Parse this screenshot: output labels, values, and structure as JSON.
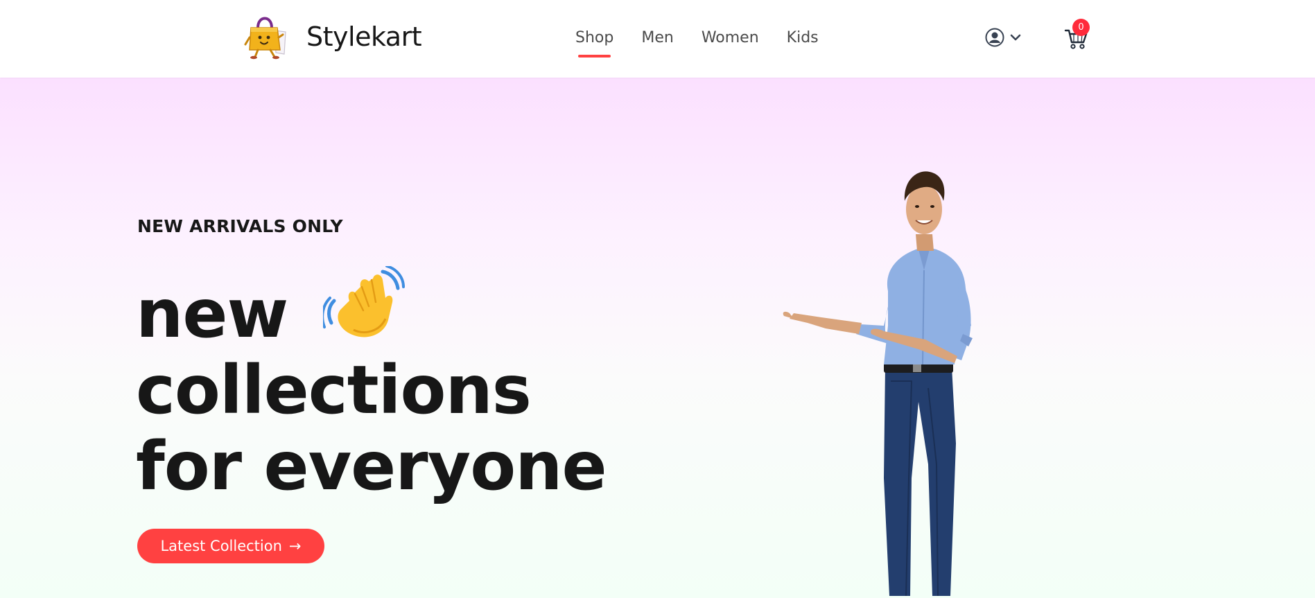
{
  "header": {
    "brand": {
      "name": "Stylekart",
      "logo_icon": "shopping-bag-mascot-icon"
    },
    "nav": [
      {
        "label": "Shop",
        "active": true
      },
      {
        "label": "Men",
        "active": false
      },
      {
        "label": "Women",
        "active": false
      },
      {
        "label": "Kids",
        "active": false
      }
    ],
    "user_menu": {
      "icon": "user-circle-icon",
      "caret_icon": "chevron-down-icon"
    },
    "cart": {
      "icon": "cart-icon",
      "count": "0"
    }
  },
  "hero": {
    "eyebrow": "NEW ARRIVALS ONLY",
    "headline": {
      "line1": "new",
      "line2": "collections",
      "line3": "for everyone",
      "emoji_icon": "waving-hand-icon"
    },
    "cta": {
      "label": "Latest Collection",
      "arrow": "→"
    },
    "image": {
      "icon": "hero-model-image"
    }
  },
  "colors": {
    "accent": "#ff4141",
    "badge": "#ff2b3b",
    "hero_gradient_top": "#fbe0ff",
    "hero_gradient_bottom": "#f3fff7",
    "text": "#171717"
  }
}
